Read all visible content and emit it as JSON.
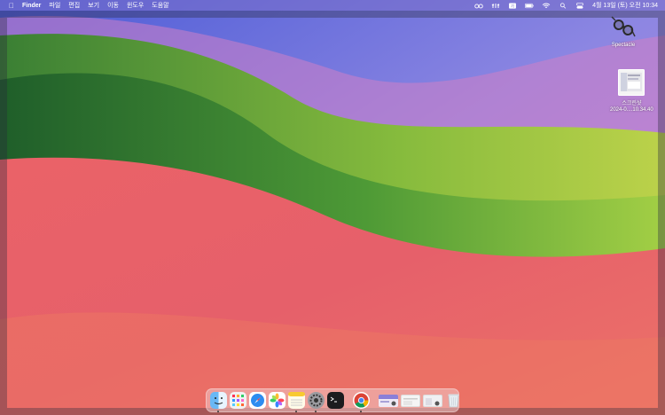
{
  "menubar": {
    "app_name": "Finder",
    "menus": [
      "파일",
      "편집",
      "보기",
      "이동",
      "윈도우",
      "도움말"
    ],
    "clock": "4월 13일 (토) 오전 10:34"
  },
  "desktop_icons": {
    "spectacle": {
      "label": "Spectacle"
    },
    "screenshot": {
      "label_line1": "스크린샷",
      "label_line2": "2024-0....10.34.40"
    }
  },
  "dock": {
    "apps": [
      "finder-icon",
      "launchpad-icon",
      "safari-icon",
      "photos-icon",
      "notes-icon",
      "system-settings-icon",
      "terminal-icon",
      "chrome-icon"
    ],
    "recents": [
      "document-thumbnail-1",
      "document-thumbnail-2",
      "document-thumbnail-3",
      "trash-icon"
    ]
  },
  "colors": {
    "menubar": "#7a6ec8",
    "wallpaper_green": "#6aa83a",
    "wallpaper_red": "#e9656e",
    "wallpaper_sky": "#7f86e0"
  }
}
